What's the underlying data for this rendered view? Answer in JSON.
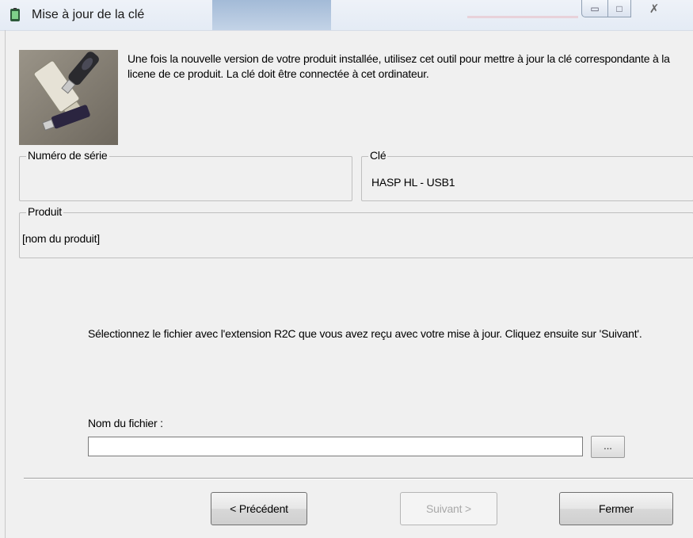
{
  "window": {
    "title": "Mise à jour de la clé",
    "controls": {
      "minimize_icon": "minimize-icon",
      "maximize_icon": "maximize-icon",
      "close_icon": "close-icon"
    }
  },
  "intro": {
    "image_icon": "usb-dongle-photo",
    "text": "Une fois la nouvelle version de votre produit installée, utilisez cet outil pour mettre à jour la clé correspondante à la licene de ce produit. La clé doit être connectée à cet ordinateur."
  },
  "serial": {
    "label": "Numéro de série",
    "value": ""
  },
  "key": {
    "label": "Clé",
    "value": "HASP HL - USB1"
  },
  "product": {
    "label": "Produit",
    "value": "[nom du produit]"
  },
  "instruction": "Sélectionnez le fichier avec l'extension R2C que vous avez reçu avec votre mise à jour. Cliquez ensuite sur 'Suivant'.",
  "file": {
    "label": "Nom du fichier :",
    "value": "",
    "browse_label": "..."
  },
  "buttons": {
    "previous": "< Précédent",
    "next": "Suivant >",
    "close": "Fermer"
  },
  "colors": {
    "window_bg": "#f0f0f0",
    "disabled_text": "#a8a8a8",
    "titlebar": "#e4ebf5"
  }
}
